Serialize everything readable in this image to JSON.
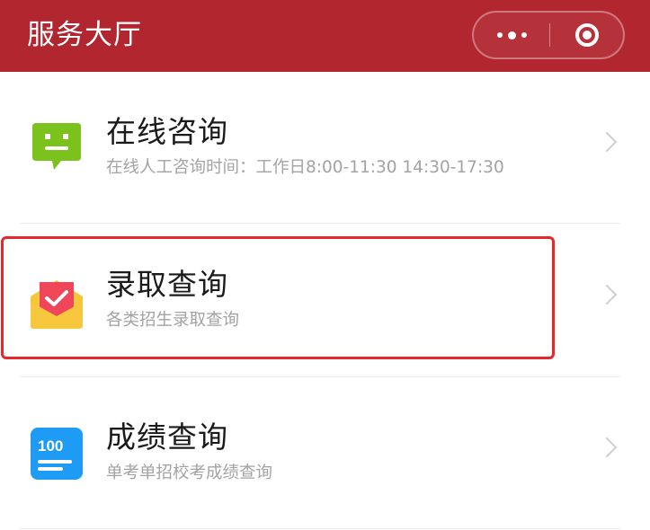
{
  "header": {
    "title": "服务大厅",
    "more_icon": "more-dots-icon",
    "close_icon": "target-circle-icon",
    "background_color": "#b1262f"
  },
  "items": [
    {
      "title": "在线咨询",
      "subtitle": "在线人工咨询时间：工作日8:00-11:30 14:30-17:30",
      "icon": "chat-bubble-icon",
      "icon_color": "#7cc21c"
    },
    {
      "title": "录取查询",
      "subtitle": "各类招生录取查询",
      "icon": "envelope-check-icon",
      "icon_color": "#f5c53a",
      "highlighted": true
    },
    {
      "title": "成绩查询",
      "subtitle": "单考单招校考成绩查询",
      "icon": "score-board-icon",
      "icon_color": "#1e9cf5",
      "icon_text": "100"
    }
  ],
  "highlight_color": "#e8262b"
}
